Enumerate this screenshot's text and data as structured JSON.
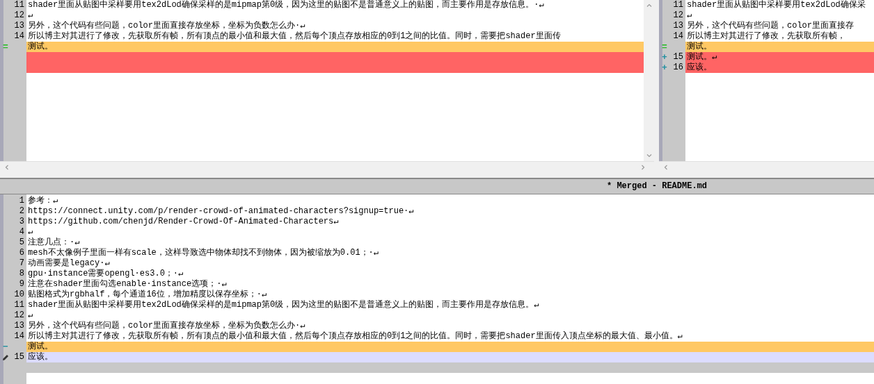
{
  "panes": [
    {
      "lines": [
        {
          "kind": "normal",
          "number": "11",
          "text": "shader里面从贴图中采样要用tex2dLod确保采样的是mipmap第0级，因为这里的贴图不是普通意义上的贴图，而主要作用是存放信息。·↵"
        },
        {
          "kind": "normal",
          "number": "12",
          "text": "↵"
        },
        {
          "kind": "normal",
          "number": "13",
          "text": "另外，这个代码有些问题，color里面直接存放坐标，坐标为负数怎么办·↵"
        },
        {
          "kind": "normal",
          "number": "14",
          "text": "所以博主对其进行了修改，先获取所有帧，所有顶点的最小值和最大值，然后每个顶点存放相应的0到1之间的比值。同时，需要把shader里面传"
        },
        {
          "kind": "conflict",
          "marker": {
            "kind": "text",
            "text": "=",
            "color": "#22bb22"
          },
          "text": "测试。"
        },
        {
          "kind": "removed"
        },
        {
          "kind": "removed"
        }
      ]
    },
    {
      "lines": [
        {
          "kind": "normal",
          "number": "11",
          "text": "shader里面从贴图中采样要用tex2dLod确保采"
        },
        {
          "kind": "normal",
          "number": "12",
          "text": "↵"
        },
        {
          "kind": "normal",
          "number": "13",
          "text": "另外，这个代码有些问题，color里面直接存"
        },
        {
          "kind": "normal",
          "number": "14",
          "text": "所以博主对其进行了修改，先获取所有帧，"
        },
        {
          "kind": "conflict",
          "marker": {
            "kind": "text",
            "text": "=",
            "color": "#22bb22"
          },
          "text": "测试。"
        },
        {
          "kind": "added",
          "marker": {
            "kind": "text",
            "text": "+",
            "color": "#1f8fa0"
          },
          "number": "15",
          "text": "测试。↵"
        },
        {
          "kind": "added",
          "marker": {
            "kind": "text",
            "text": "+",
            "color": "#1f8fa0"
          },
          "number": "16",
          "text": "应该。"
        }
      ]
    }
  ],
  "merged": {
    "title": "* Merged - README.md",
    "lines": [
      {
        "kind": "normal",
        "number": "1",
        "text": "参考：↵"
      },
      {
        "kind": "normal",
        "number": "2",
        "text": "https://connect.unity.com/p/render-crowd-of-animated-characters?signup=true·↵"
      },
      {
        "kind": "normal",
        "number": "3",
        "text": "https://github.com/chenjd/Render-Crowd-Of-Animated-Characters↵"
      },
      {
        "kind": "normal",
        "number": "4",
        "text": "↵"
      },
      {
        "kind": "normal",
        "number": "5",
        "text": "注意几点：·↵"
      },
      {
        "kind": "normal",
        "number": "6",
        "text": "mesh不太像例子里面一样有scale，这样导致选中物体却找不到物体，因为被缩放为0.01；·↵"
      },
      {
        "kind": "normal",
        "number": "7",
        "text": "动画需要是legacy·↵"
      },
      {
        "kind": "normal",
        "number": "8",
        "text": "gpu·instance需要opengl·es3.0；·↵"
      },
      {
        "kind": "normal",
        "number": "9",
        "text": "注意在shader里面勾选enable·instance选项；·↵"
      },
      {
        "kind": "normal",
        "number": "10",
        "text": "贴图格式为rgbhalf，每个通道16位，增加精度以保存坐标；·↵"
      },
      {
        "kind": "normal",
        "number": "11",
        "text": "shader里面从贴图中采样要用tex2dLod确保采样的是mipmap第0级，因为这里的贴图不是普通意义上的贴图，而主要作用是存放信息。↵"
      },
      {
        "kind": "normal",
        "number": "12",
        "text": "↵"
      },
      {
        "kind": "normal",
        "number": "13",
        "text": "另外，这个代码有些问题，color里面直接存放坐标，坐标为负数怎么办·↵"
      },
      {
        "kind": "normal",
        "number": "14",
        "text": "所以博主对其进行了修改，先获取所有帧，所有顶点的最小值和最大值，然后每个顶点存放相应的0到1之间的比值。同时，需要把shader里面传入顶点坐标的最大值、最小值。↵"
      },
      {
        "kind": "conflict",
        "marker": {
          "kind": "text",
          "text": "−",
          "color": "#1f8fa0"
        },
        "text": "测试。"
      },
      {
        "kind": "edited",
        "marker": {
          "kind": "pencil"
        },
        "number": "15",
        "text": "应该。"
      },
      {
        "kind": "filler"
      }
    ]
  }
}
